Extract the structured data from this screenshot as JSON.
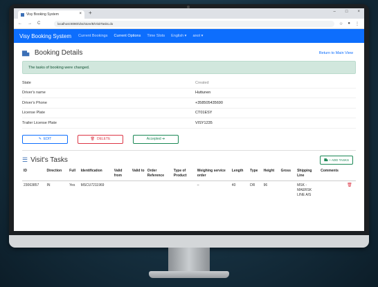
{
  "browser": {
    "tab_title": "Visy Booking System",
    "tab_close": "×",
    "new_tab": "+",
    "window_controls": [
      "–",
      "□",
      "×"
    ],
    "nav_icons": [
      "←",
      "→",
      "C"
    ],
    "url": "localhost:8080/vbs/store/B/VisitTasks.do",
    "right_icons": [
      "☆",
      "●",
      "⋮"
    ]
  },
  "navbar": {
    "brand": "Visy Booking System",
    "links": [
      "Current Bookings",
      "Current Options",
      "Time Slots",
      "English ▾",
      "anot ▾"
    ]
  },
  "booking": {
    "title": "Booking Details",
    "return_label": "Return to Main View",
    "alert": "The tasks of booking were changed.",
    "fields": [
      {
        "label": "State",
        "value": "Created"
      },
      {
        "label": "Driver's name",
        "value": "Huttunen"
      },
      {
        "label": "Driver's Phone",
        "value": "+358505435690"
      },
      {
        "label": "License Plate",
        "value": "CT01ESY"
      },
      {
        "label": "Trailer License Plate",
        "value": "VISY1235"
      }
    ],
    "buttons": {
      "edit": "EDIT",
      "delete": "DELETE",
      "accept": "Accepted ➔"
    }
  },
  "tasks": {
    "title": "Visit's Tasks",
    "add_label": "+ ADD TASKS",
    "columns": [
      "ID",
      "Direction",
      "Full",
      "Identification",
      "Valid from",
      "Valid to",
      "Order Reference",
      "Type of Product",
      "Weighing service order",
      "Length",
      "Type",
      "Height",
      "Gross",
      "Shipping Line",
      "Comments"
    ],
    "rows": [
      [
        "23063857",
        "IN",
        "Yes",
        "MSCU7211969",
        "",
        "",
        "",
        "",
        "–",
        "40",
        "DR",
        "96",
        "",
        "MSK - MAERSK LINE A/S",
        ""
      ]
    ]
  },
  "colors": {
    "primary": "#0d6efd",
    "success": "#198754",
    "danger": "#dc3545",
    "alert_bg": "#d1e7dd"
  }
}
